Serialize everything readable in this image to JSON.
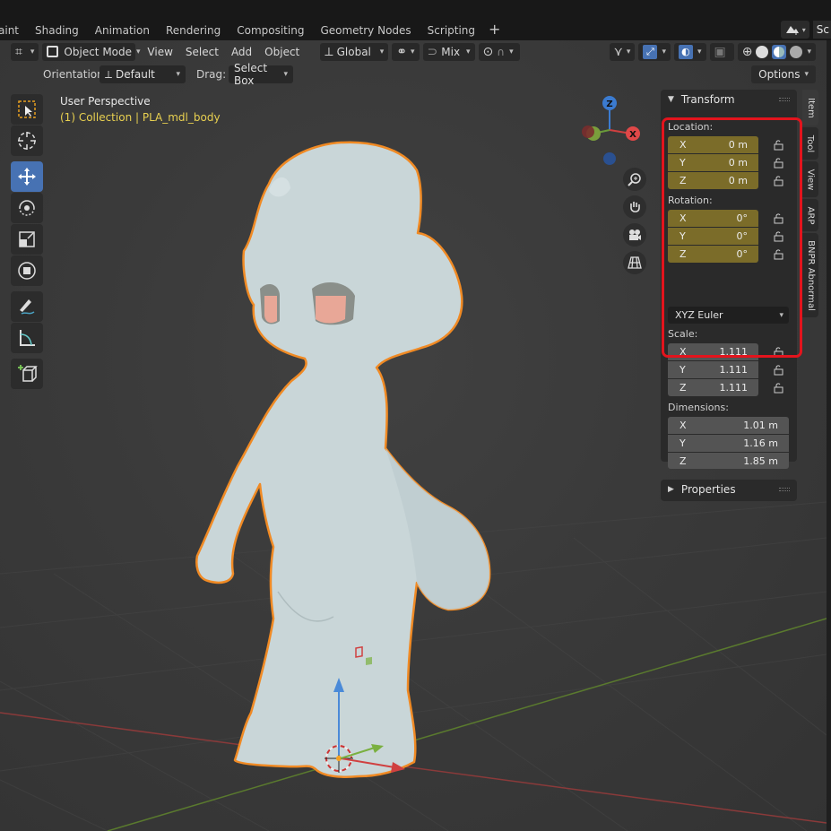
{
  "workspace_tabs": [
    "aint",
    "Shading",
    "Animation",
    "Rendering",
    "Compositing",
    "Geometry Nodes",
    "Scripting"
  ],
  "scene_label": "Sc",
  "header": {
    "mode": "Object Mode",
    "menus": [
      "View",
      "Select",
      "Add",
      "Object"
    ],
    "transform_orientation": "Global",
    "snap_mode": "Mix"
  },
  "subheader": {
    "orientation_label": "Orientation:",
    "orientation_value": "Default",
    "drag_label": "Drag:",
    "drag_value": "Select Box",
    "options_label": "Options"
  },
  "viewport_info": {
    "perspective": "User Perspective",
    "collection": "(1) Collection | PLA_mdl_body"
  },
  "gizmo": {
    "z": "Z",
    "x": "X"
  },
  "npanel": {
    "transform_title": "Transform",
    "location_label": "Location:",
    "location": [
      {
        "axis": "X",
        "value": "0 m"
      },
      {
        "axis": "Y",
        "value": "0 m"
      },
      {
        "axis": "Z",
        "value": "0 m"
      }
    ],
    "rotation_label": "Rotation:",
    "rotation": [
      {
        "axis": "X",
        "value": "0°"
      },
      {
        "axis": "Y",
        "value": "0°"
      },
      {
        "axis": "Z",
        "value": "0°"
      }
    ],
    "rotation_mode": "XYZ Euler",
    "scale_label": "Scale:",
    "scale": [
      {
        "axis": "X",
        "value": "1.111"
      },
      {
        "axis": "Y",
        "value": "1.111"
      },
      {
        "axis": "Z",
        "value": "1.111"
      }
    ],
    "dimensions_label": "Dimensions:",
    "dimensions": [
      {
        "axis": "X",
        "value": "1.01 m"
      },
      {
        "axis": "Y",
        "value": "1.16 m"
      },
      {
        "axis": "Z",
        "value": "1.85 m"
      }
    ],
    "properties_title": "Properties"
  },
  "side_tabs": [
    "Item",
    "Tool",
    "View",
    "ARP",
    "BNPR Abnormal"
  ],
  "colors": {
    "accent": "#4772b3",
    "keyed_field": "#7b6c29",
    "highlight": "#e3141d",
    "selection_outline": "#f08a24"
  }
}
